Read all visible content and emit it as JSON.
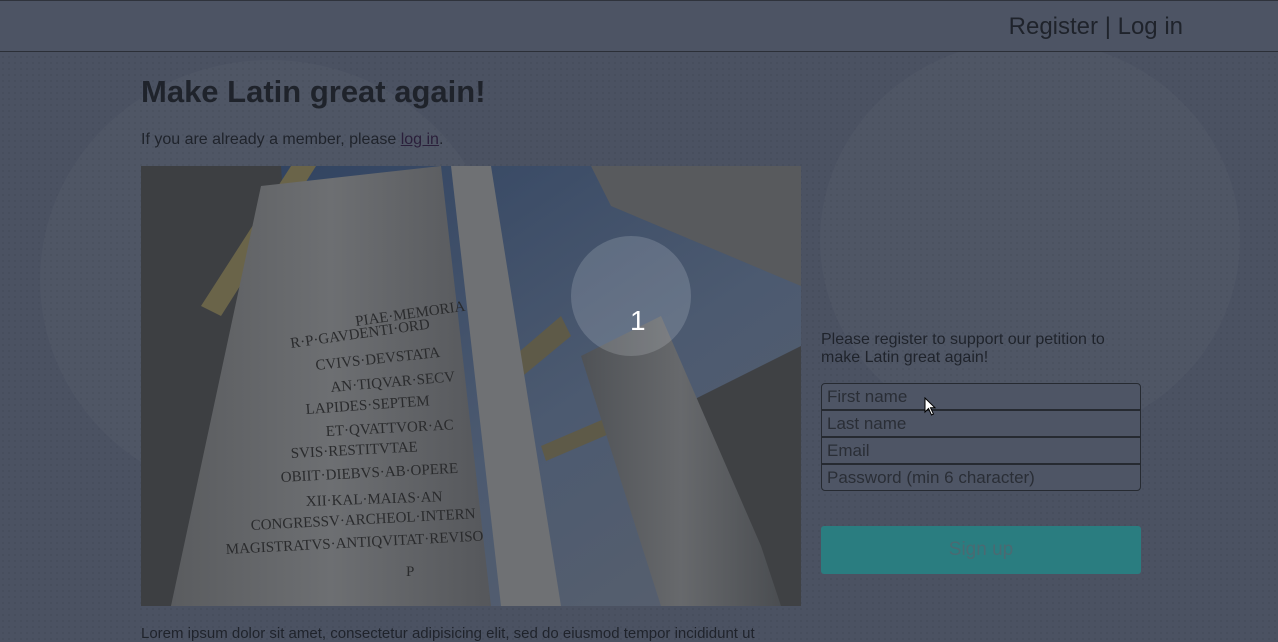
{
  "header": {
    "register_label": "Register",
    "separator": "|",
    "login_label": "Log in"
  },
  "main": {
    "title": "Make Latin great again!",
    "intro_text": "If you are already a member, please ",
    "intro_link": "log in",
    "intro_end": ".",
    "slide_number": "1",
    "lorem": "Lorem ipsum dolor sit amet, consectetur adipisicing elit, sed do eiusmod tempor incididunt ut"
  },
  "form": {
    "note": "Please register to support our petition to make Latin great again!",
    "first_name_placeholder": "First name",
    "last_name_placeholder": "Last name",
    "email_placeholder": "Email",
    "password_placeholder": "Password (min 6 character)",
    "submit_label": "Sign up"
  },
  "colors": {
    "overlay": "#4b5262",
    "accent": "#2a7d80"
  }
}
